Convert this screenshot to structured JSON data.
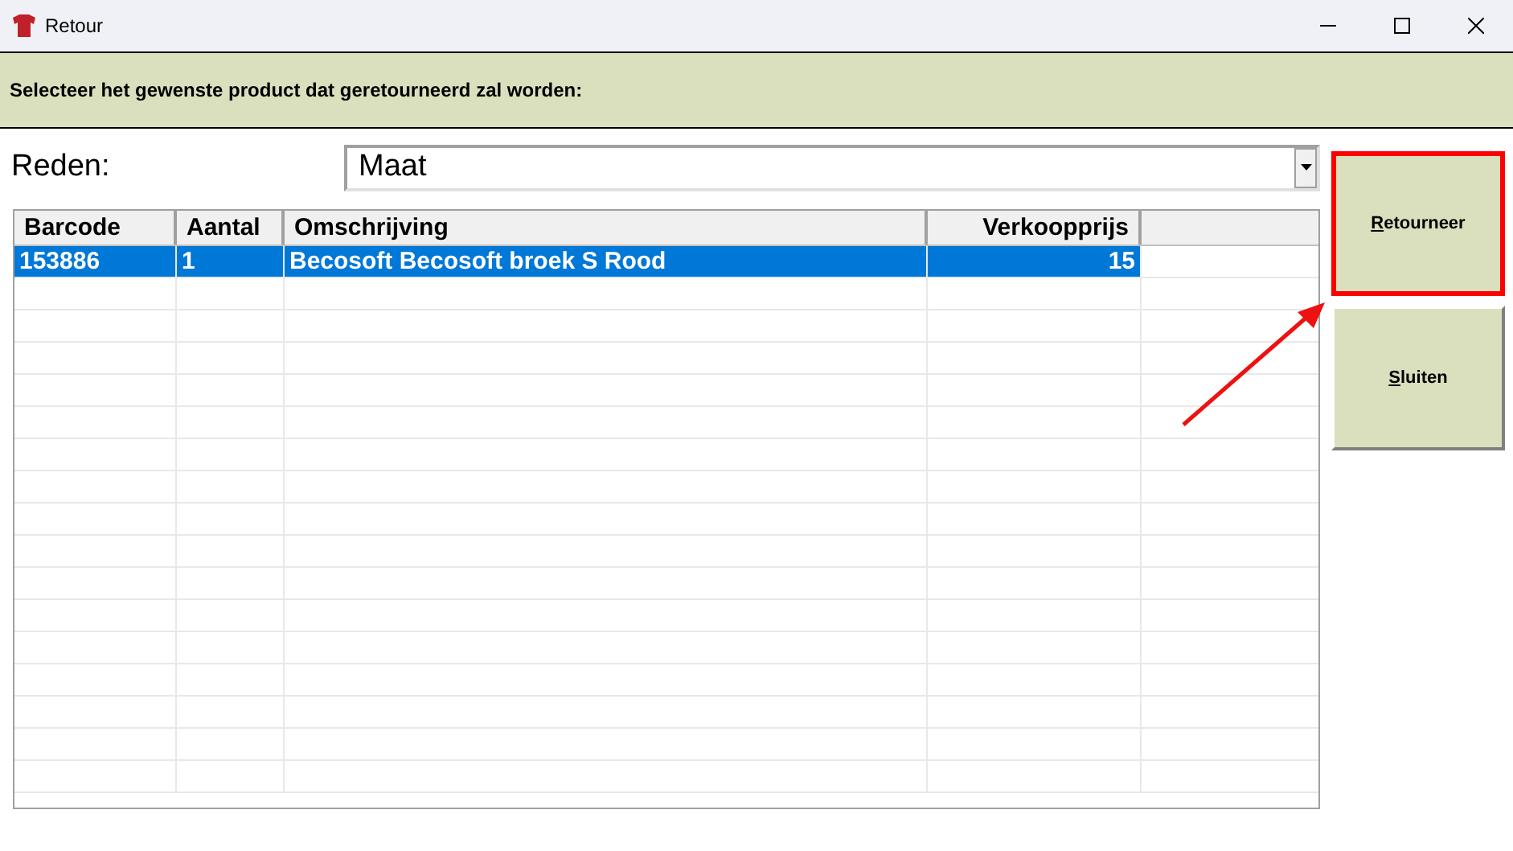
{
  "window": {
    "title": "Retour"
  },
  "instruction": "Selecteer het gewenste product dat geretourneerd zal worden:",
  "reason": {
    "label": "Reden:",
    "value": "Maat"
  },
  "table": {
    "columns": [
      {
        "label": "Barcode"
      },
      {
        "label": "Aantal"
      },
      {
        "label": "Omschrijving"
      },
      {
        "label": "Verkoopprijs"
      }
    ],
    "rows": [
      {
        "cells": [
          "153886",
          "1",
          "Becosoft Becosoft broek  S Rood",
          "15"
        ],
        "selected": true
      }
    ]
  },
  "buttons": [
    {
      "label": "Retourneer",
      "highlighted": true
    },
    {
      "label": "Sluiten",
      "highlighted": false
    }
  ]
}
